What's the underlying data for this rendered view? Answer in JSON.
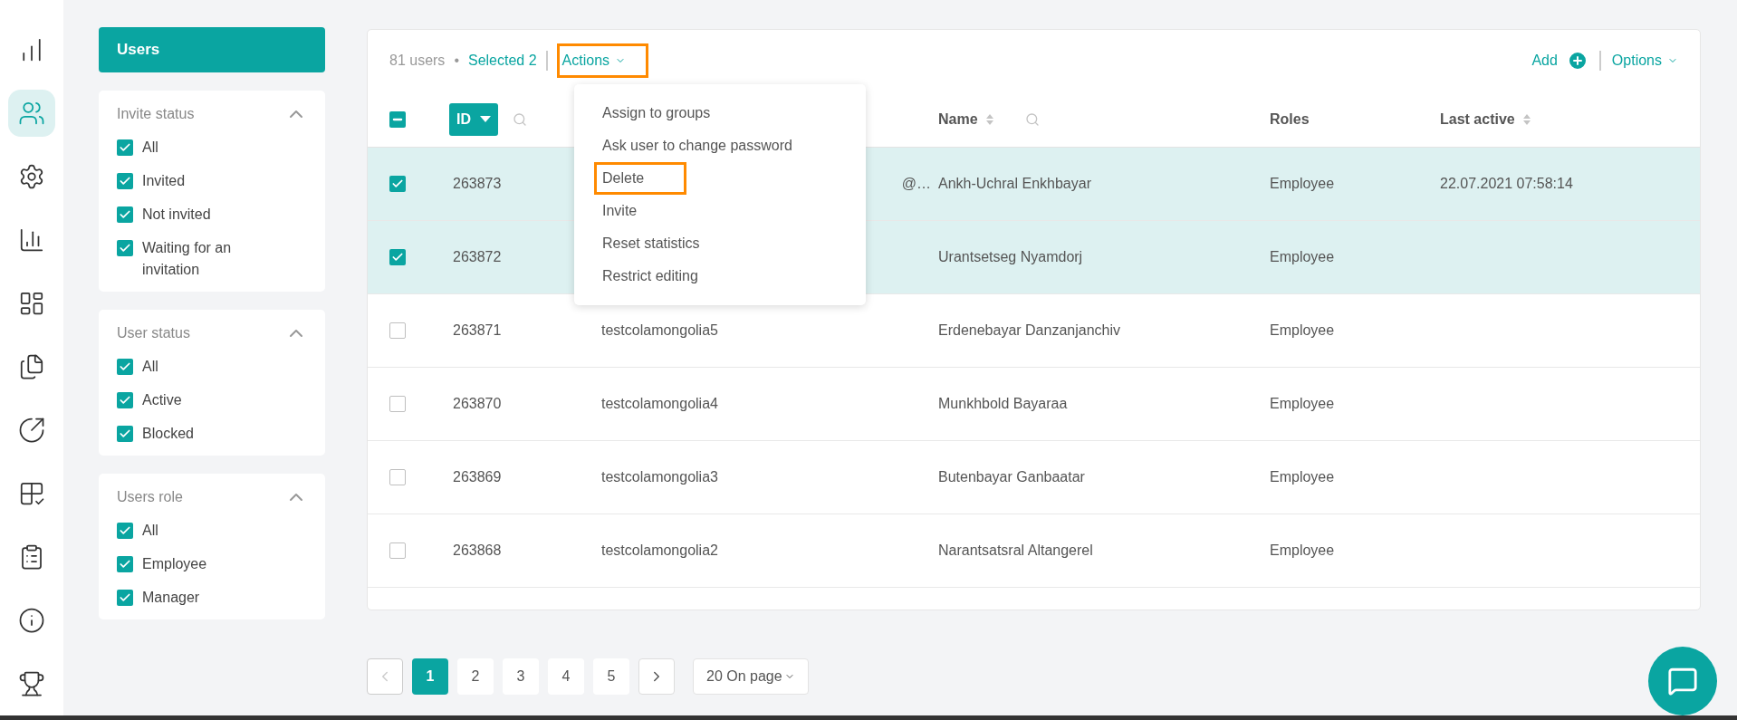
{
  "nav": [
    {
      "selected": false
    },
    {
      "selected": true
    },
    {
      "selected": false
    },
    {
      "selected": false
    },
    {
      "selected": false
    },
    {
      "selected": false
    },
    {
      "selected": false
    },
    {
      "selected": false
    },
    {
      "selected": false
    },
    {
      "selected": false
    },
    {
      "selected": false
    }
  ],
  "section_button": "Users",
  "filters": [
    {
      "title": "Invite status",
      "expanded": true,
      "options": [
        {
          "label": "All",
          "checked": true
        },
        {
          "label": "Invited",
          "checked": true
        },
        {
          "label": "Not invited",
          "checked": true
        },
        {
          "label": "Waiting for an invitation",
          "checked": true
        }
      ]
    },
    {
      "title": "User status",
      "expanded": true,
      "options": [
        {
          "label": "All",
          "checked": true
        },
        {
          "label": "Active",
          "checked": true
        },
        {
          "label": "Blocked",
          "checked": true
        }
      ]
    },
    {
      "title": "Users role",
      "expanded": true,
      "options": [
        {
          "label": "All",
          "checked": true
        },
        {
          "label": "Employee",
          "checked": true
        },
        {
          "label": "Manager",
          "checked": true
        }
      ]
    }
  ],
  "toolbar": {
    "count": "81 users",
    "separator": "•",
    "selected": "Selected 2",
    "actions": {
      "label": "Actions",
      "highlighted": true
    },
    "add": "Add",
    "options": "Options"
  },
  "actions_menu": [
    {
      "label": "Assign to groups",
      "highlighted": false
    },
    {
      "label": "Ask user to change password",
      "highlighted": false
    },
    {
      "label": "Delete",
      "highlighted": true
    },
    {
      "label": "Invite",
      "highlighted": false
    },
    {
      "label": "Reset statistics",
      "highlighted": false
    },
    {
      "label": "Restrict editing",
      "highlighted": false
    }
  ],
  "table": {
    "select_all_partial": true,
    "columns": [
      {
        "label": "ID",
        "kind": "sort-button"
      },
      {
        "label": "Name",
        "kind": "sortable-search"
      },
      {
        "label": "Roles",
        "kind": "plain"
      },
      {
        "label": "Last active",
        "kind": "sortable"
      }
    ],
    "rows": [
      {
        "checked": true,
        "id": "263873",
        "login": "@…",
        "name": "Ankh-Uchral Enkhbayar",
        "role": "Employee",
        "last_active": "22.07.2021 07:58:14"
      },
      {
        "checked": true,
        "id": "263872",
        "name": "Urantsetseg Nyamdorj",
        "role": "Employee"
      },
      {
        "checked": false,
        "id": "263871",
        "login": "testcolamongolia5",
        "name": "Erdenebayar Danzanjanchiv",
        "role": "Employee"
      },
      {
        "checked": false,
        "id": "263870",
        "login": "testcolamongolia4",
        "name": "Munkhbold Bayaraa",
        "role": "Employee"
      },
      {
        "checked": false,
        "id": "263869",
        "login": "testcolamongolia3",
        "name": "Butenbayar Ganbaatar",
        "role": "Employee"
      },
      {
        "checked": false,
        "id": "263868",
        "login": "testcolamongolia2",
        "name": "Narantsatsral Altangerel",
        "role": "Employee"
      }
    ]
  },
  "pagination": {
    "prev_disabled": true,
    "pages": [
      {
        "label": "1",
        "selected": true
      },
      {
        "label": "2",
        "selected": false
      },
      {
        "label": "3",
        "selected": false
      },
      {
        "label": "4",
        "selected": false
      },
      {
        "label": "5",
        "selected": false
      }
    ],
    "per_page": "20 On page"
  }
}
